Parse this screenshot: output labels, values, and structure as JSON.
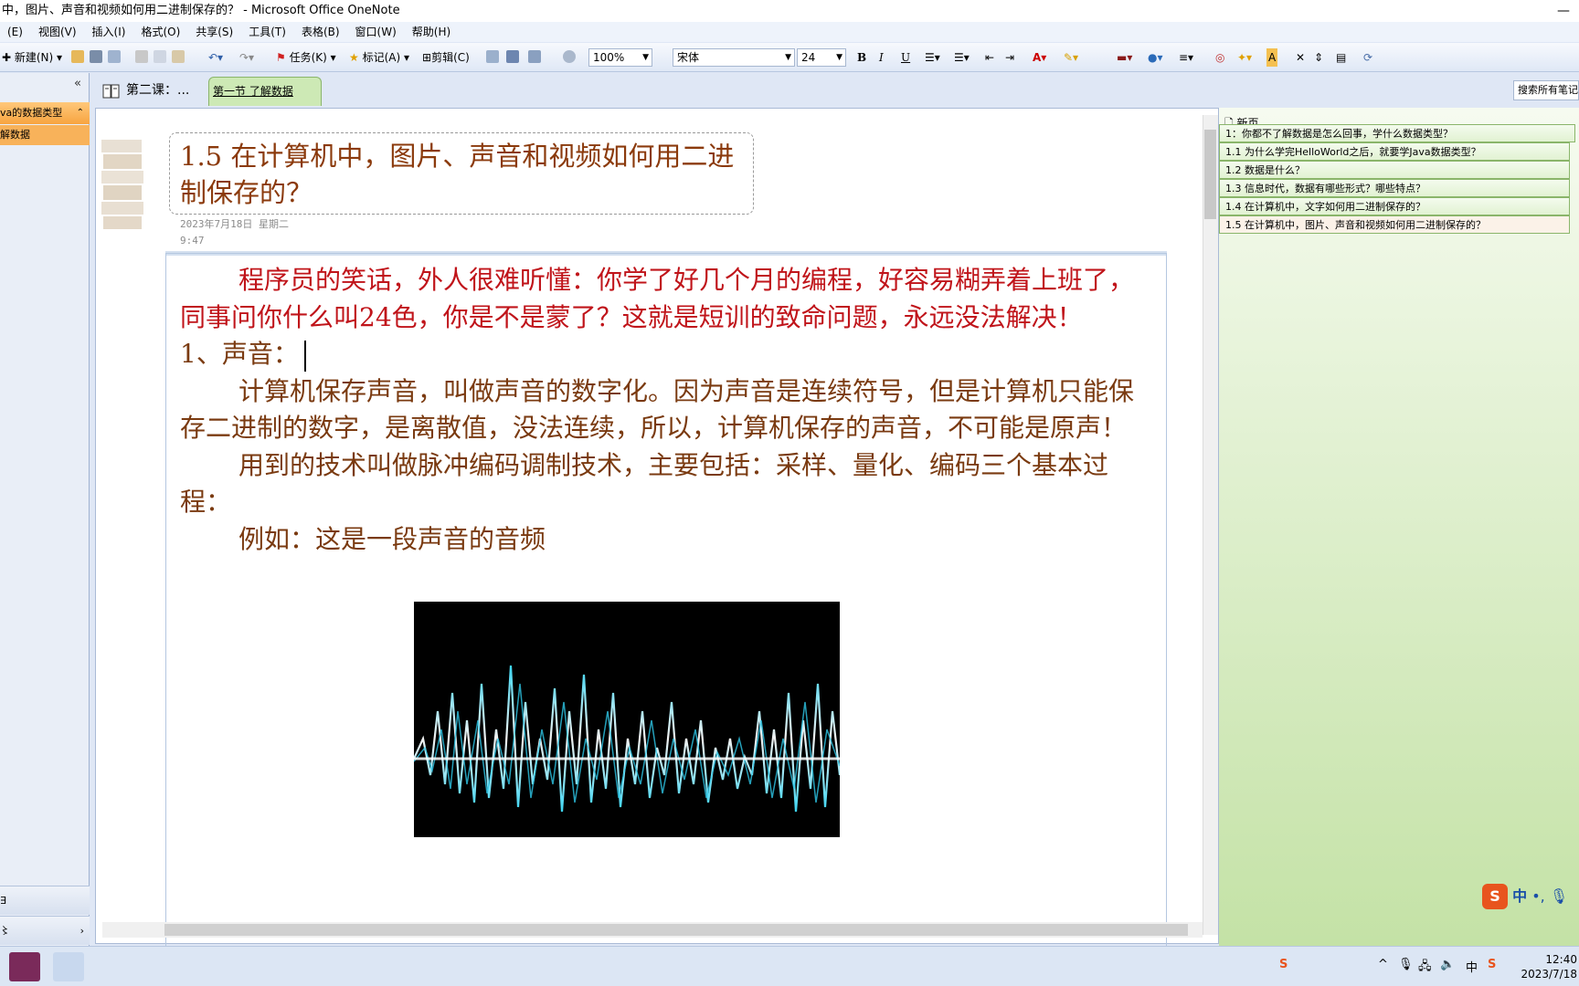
{
  "window": {
    "title": "中，图片、声音和视频如何用二进制保存的？ - Microsoft Office OneNote",
    "minimize_icon": "minimize-icon"
  },
  "menu": [
    "(E)",
    "视图(V)",
    "插入(I)",
    "格式(O)",
    "共享(S)",
    "工具(T)",
    "表格(B)",
    "窗口(W)",
    "帮助(H)"
  ],
  "toolbar": {
    "new_label": "新建(N)",
    "task_label": "任务(K)",
    "tag_label": "标记(A)",
    "clip_label": "剪辑(C)",
    "zoom": "100%",
    "font": "宋体",
    "size": "24",
    "bold": "B",
    "italic": "I",
    "underline": "U"
  },
  "leftnav": {
    "notebook": "va的数据类型",
    "section": "解数据",
    "bottom1": "∃",
    "bottom2": "〻"
  },
  "tabs": {
    "section_group": "第二课：...",
    "active_section": "第一节  了解数据",
    "search_placeholder": "搜索所有笔记本"
  },
  "page": {
    "title": "1.5  在计算机中，图片、声音和视频如何用二进制保存的？",
    "date": "2023年7月18日 星期二",
    "time": "9:47",
    "para1": "程序员的笑话，外人很难听懂：你学了好几个月的编程，好容易糊弄着上班了，同事问你什么叫24色，你是不是蒙了？这就是短训的致命问题，永远没法解决！",
    "heading1": "1、声音：",
    "para2": "计算机保存声音，叫做声音的数字化。因为声音是连续符号，但是计算机只能保存二进制的数字，是离散值，没法连续，所以，计算机保存的声音，不可能是原声！",
    "para3": "用到的技术叫做脉冲编码调制技术，主要包括：采样、量化、编码三个基本过程：",
    "para4": "例如：这是一段声音的音频"
  },
  "rightpane": {
    "new_page": "新页",
    "pages": [
      "1：你都不了解数据是怎么回事，学什么数据类型？",
      "1.1  为什么学完HelloWorld之后，就要学Java数据类型？",
      "1.2  数据是什么？",
      "1.3  信息时代，数据有哪些形式？哪些特点？",
      "1.4  在计算机中，文字如何用二进制保存的？",
      "1.5  在计算机中，图片、声音和视频如何用二进制保存的？"
    ],
    "selected_index": 5
  },
  "ime": {
    "label": "中",
    "punct": "•,"
  },
  "taskbar": {
    "time": "12:40",
    "date": "2023/7/18",
    "input_lang": "中"
  },
  "colors": {
    "title_text": "#8b3a0c",
    "red_text": "#c0141a",
    "body_text": "#7a3a10",
    "active_tab": "#cde9b5",
    "nav_orange": "#f7a440"
  }
}
